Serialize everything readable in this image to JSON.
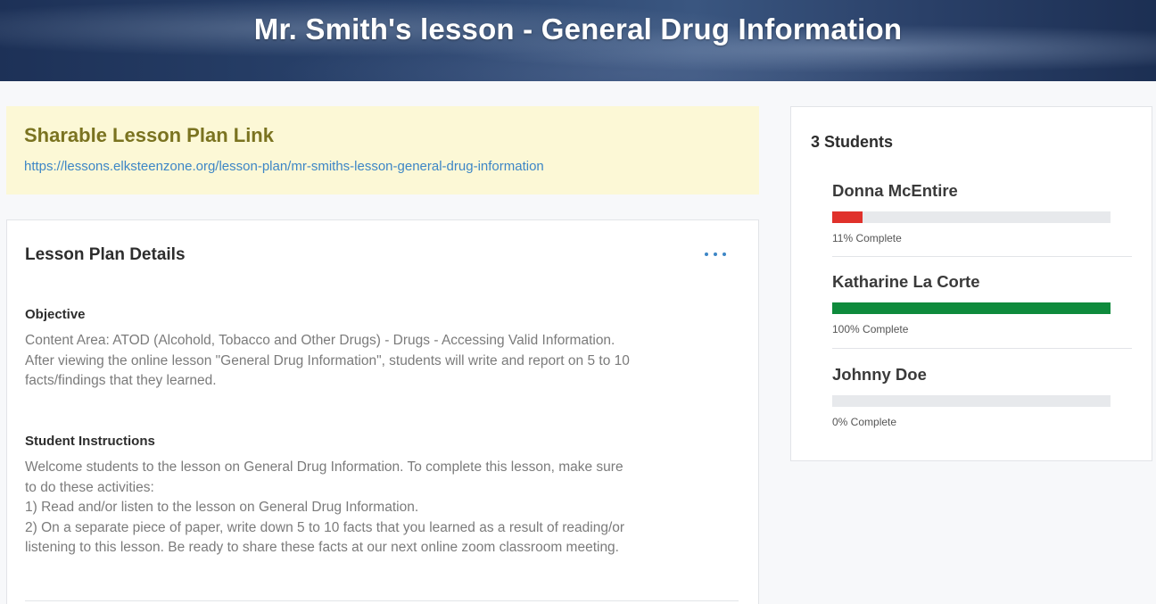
{
  "header": {
    "title": "Mr. Smith's lesson - General Drug Information"
  },
  "share": {
    "title": "Sharable Lesson Plan Link",
    "link": "https://lessons.elksteenzone.org/lesson-plan/mr-smiths-lesson-general-drug-information"
  },
  "details": {
    "title": "Lesson Plan Details",
    "more_icon": "more-horizontal-icon",
    "objective": {
      "heading": "Objective",
      "lines": [
        "Content Area: ATOD (Alcohold, Tobacco and Other Drugs) - Drugs - Accessing Valid Information.",
        "After viewing the online lesson \"General Drug Information\", students will write and report on 5 to 10",
        "facts/findings that they learned."
      ]
    },
    "instructions": {
      "heading": "Student Instructions",
      "lines": [
        "Welcome students to the lesson on General Drug Information. To complete this lesson, make sure",
        "to do these activities:",
        "1) Read and/or listen to the lesson on General Drug Information.",
        "2) On a separate piece of paper, write down 5 to 10 facts that you learned as a result of reading/or",
        "listening to this lesson. Be ready to share these facts at our next online zoom classroom meeting."
      ]
    }
  },
  "students": {
    "title": "3 Students",
    "items": [
      {
        "name": "Donna McEntire",
        "progress": 11,
        "status": "11% Complete",
        "color": "#e0312b"
      },
      {
        "name": "Katharine La Corte",
        "progress": 100,
        "status": "100% Complete",
        "color": "#0e8a3c"
      },
      {
        "name": "Johnny Doe",
        "progress": 0,
        "status": "0% Complete",
        "color": "#0e8a3c"
      }
    ]
  },
  "colors": {
    "banner": "#1d3157",
    "share_bg": "#fcf8d6",
    "share_title": "#7a7320",
    "link": "#3d86c6",
    "progress_track": "#e7e9ec"
  }
}
